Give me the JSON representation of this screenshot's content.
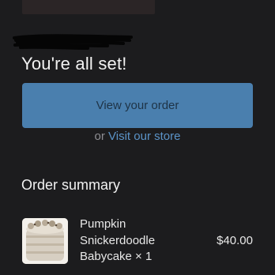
{
  "confirmation": {
    "headline": "You're all set!",
    "view_order_label": "View your order",
    "or_text": "or",
    "visit_store_label": "Visit our store"
  },
  "summary": {
    "title": "Order summary",
    "items": [
      {
        "name": "Pumpkin Snickerdoodle Babycake × 1",
        "price": "$40.00"
      }
    ]
  },
  "colors": {
    "background": "#1c1c1e",
    "primary_button": "#4a7fae",
    "link": "#5b93c7",
    "muted_text": "#8e8e93"
  }
}
